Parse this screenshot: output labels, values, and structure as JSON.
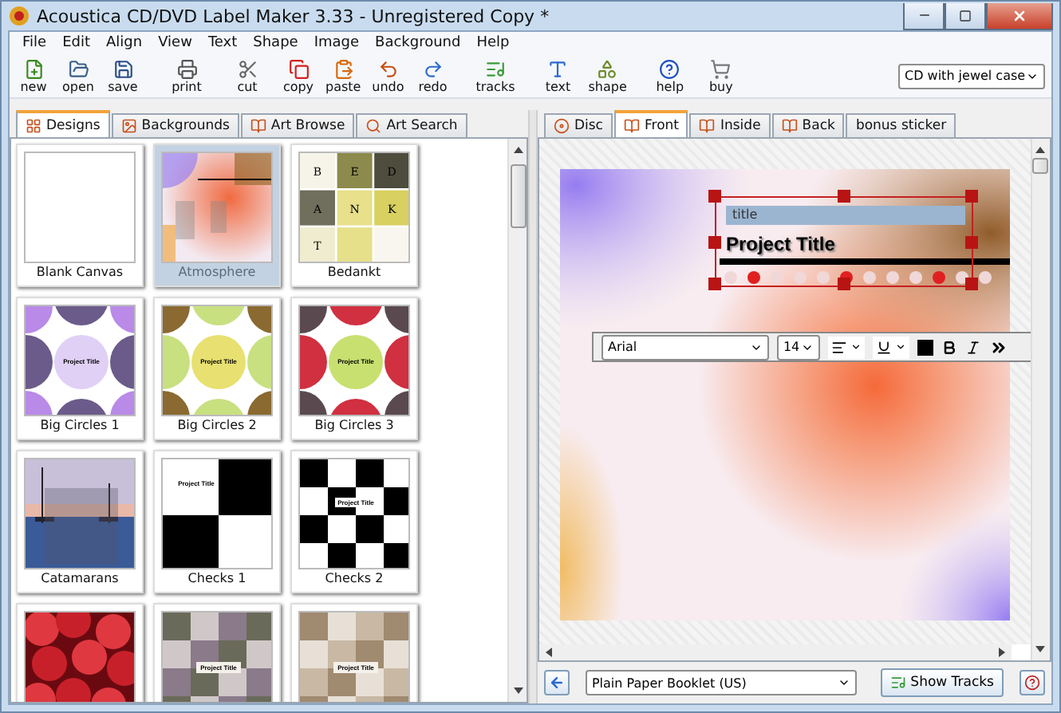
{
  "window": {
    "title": "Acoustica CD/DVD Label Maker 3.33 - Unregistered Copy *"
  },
  "menu": [
    "File",
    "Edit",
    "Align",
    "View",
    "Text",
    "Shape",
    "Image",
    "Background",
    "Help"
  ],
  "toolbar": [
    "new",
    "open",
    "save",
    "print",
    "cut",
    "copy",
    "paste",
    "undo",
    "redo",
    "tracks",
    "text",
    "shape",
    "help",
    "buy"
  ],
  "layout_select": {
    "value": "CD with jewel case"
  },
  "left_tabs": [
    {
      "label": "Designs",
      "selected": true
    },
    {
      "label": "Backgrounds",
      "selected": false
    },
    {
      "label": "Art Browse",
      "selected": false
    },
    {
      "label": "Art Search",
      "selected": false
    }
  ],
  "designs": [
    {
      "name": "Blank Canvas",
      "selected": false,
      "kind": "blank"
    },
    {
      "name": "Atmosphere",
      "selected": true,
      "kind": "atmosphere"
    },
    {
      "name": "Bedankt",
      "selected": false,
      "kind": "letters",
      "letters": [
        "B",
        "E",
        "D",
        "A",
        "N",
        "K",
        "T"
      ]
    },
    {
      "name": "Big Circles 1",
      "selected": false,
      "kind": "circles",
      "preview_text": "Project Title"
    },
    {
      "name": "Big Circles 2",
      "selected": false,
      "kind": "circles",
      "preview_text": "Project Title"
    },
    {
      "name": "Big Circles 3",
      "selected": false,
      "kind": "circles",
      "preview_text": "Project Title"
    },
    {
      "name": "Catamarans",
      "selected": false,
      "kind": "picture"
    },
    {
      "name": "Checks 1",
      "selected": false,
      "kind": "checks",
      "preview_text": "Project Title"
    },
    {
      "name": "Checks 2",
      "selected": false,
      "kind": "checks",
      "preview_text": "Project Title"
    },
    {
      "selected": false,
      "kind": "picture"
    },
    {
      "selected": false,
      "kind": "mosaic",
      "preview_text": "Project Title"
    },
    {
      "selected": false,
      "kind": "mosaic",
      "preview_text": "Project Title"
    }
  ],
  "right_tabs": [
    {
      "label": "Disc",
      "selected": false
    },
    {
      "label": "Front",
      "selected": true
    },
    {
      "label": "Inside",
      "selected": false
    },
    {
      "label": "Back",
      "selected": false
    },
    {
      "label": "bonus sticker",
      "selected": false
    }
  ],
  "canvas": {
    "field_tag": "title",
    "title": "Project Title"
  },
  "format_bar": {
    "font": "Arial",
    "size": "14"
  },
  "bottom": {
    "paper": "Plain Paper Booklet (US)",
    "show_tracks": "Show Tracks"
  }
}
